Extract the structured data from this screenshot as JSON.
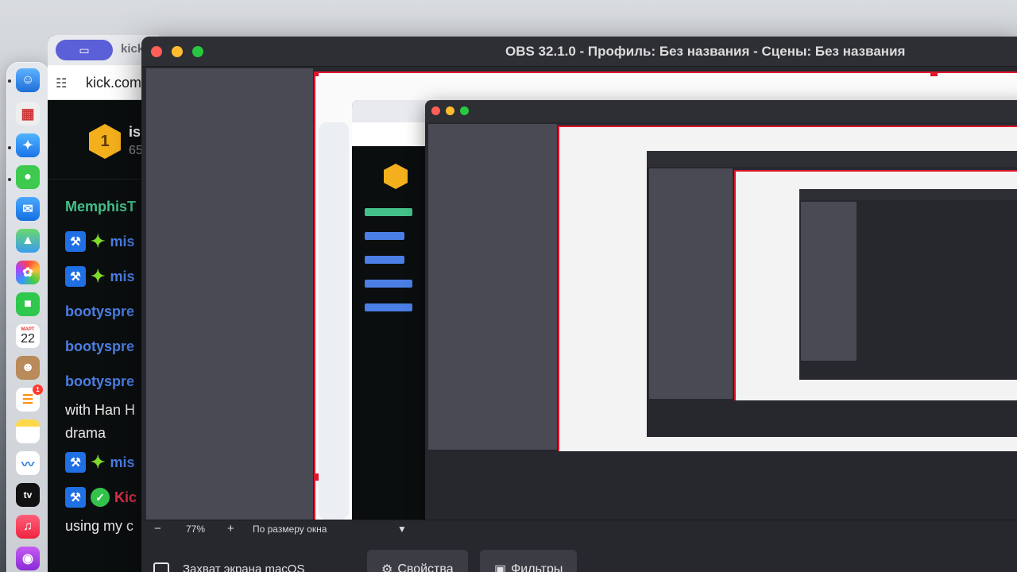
{
  "dock": {
    "calendar_month": "МАРТ",
    "calendar_day": "22",
    "reminders_badge": "1",
    "appletv_label": "tv",
    "icons": [
      "finder-icon",
      "launchpad-icon",
      "safari-icon",
      "messages-icon",
      "mail-icon",
      "maps-icon",
      "photos-icon",
      "facetime-icon",
      "calendar-icon",
      "contacts-icon",
      "reminders-icon",
      "notes-icon",
      "freeform-icon",
      "appletv-icon",
      "music-icon",
      "podcasts-icon"
    ]
  },
  "browser": {
    "tab_title": "kick",
    "url": "kick.com",
    "channel_name": "is",
    "channel_sub": "65",
    "rank_badge": "1",
    "chat": [
      {
        "type": "user",
        "text": "MemphisT",
        "color": "green"
      },
      {
        "type": "badged",
        "text": "mis",
        "color": "blue"
      },
      {
        "type": "badged",
        "text": "mis",
        "color": "blue"
      },
      {
        "type": "user",
        "text": "bootyspre",
        "color": "blue"
      },
      {
        "type": "user",
        "text": "bootyspre",
        "color": "blue"
      },
      {
        "type": "user",
        "text": "bootyspre",
        "color": "blue"
      },
      {
        "type": "msg",
        "text": "with Han H"
      },
      {
        "type": "msg",
        "text": "drama"
      },
      {
        "type": "badged",
        "text": "mis",
        "color": "blue"
      },
      {
        "type": "verified",
        "text": "Kic",
        "color": "red"
      },
      {
        "type": "msg",
        "text": "using my c"
      }
    ]
  },
  "obs": {
    "title": "OBS 32.1.0 - Профиль: Без названия - Сцены: Без названия",
    "zoom_minus": "−",
    "zoom_value": "77%",
    "zoom_plus": "+",
    "fit_mode": "По размеру окна",
    "source_name": "Захват экрана macOS",
    "properties_button": "Свойства",
    "filters_button": "Фильтры"
  }
}
